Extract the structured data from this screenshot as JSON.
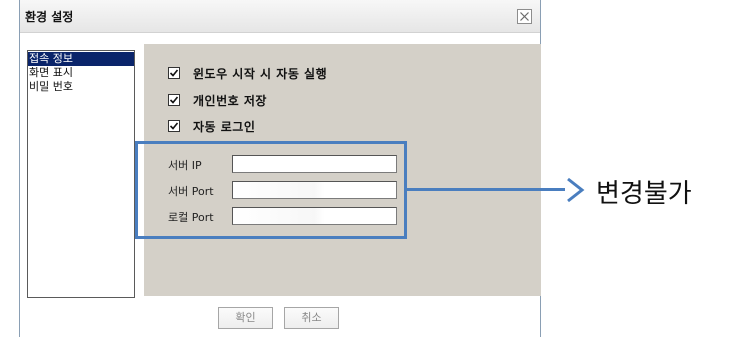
{
  "window": {
    "title": "환경 설정"
  },
  "sidebar": {
    "items": [
      {
        "label": "접속 정보",
        "selected": true
      },
      {
        "label": "화면 표시",
        "selected": false
      },
      {
        "label": "비밀 번호",
        "selected": false
      }
    ]
  },
  "options": [
    {
      "label": "윈도우 시작 시 자동 실행",
      "checked": true
    },
    {
      "label": "개인번호 저장",
      "checked": true
    },
    {
      "label": "자동 로그인",
      "checked": true
    }
  ],
  "fields": [
    {
      "label": "서버 IP",
      "value": ""
    },
    {
      "label": "서버 Port",
      "value": ""
    },
    {
      "label": "로컬 Port",
      "value": ""
    }
  ],
  "buttons": {
    "ok": "확인",
    "cancel": "취소"
  },
  "annotation": {
    "text": "변경불가"
  },
  "colors": {
    "highlight": "#4a7ebf",
    "selection": "#0a246a",
    "panel": "#d4d0c8"
  }
}
